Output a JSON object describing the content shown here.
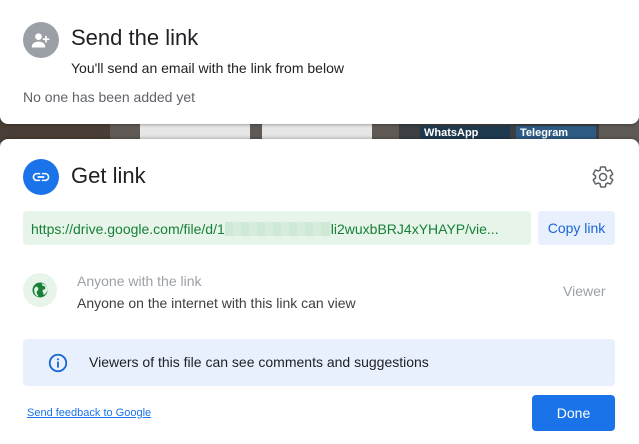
{
  "send_dialog": {
    "title": "Send the link",
    "subtitle": "You'll send an email with the link from below",
    "empty_state": "No one has been added yet"
  },
  "background": {
    "tags": [
      "WhatsApp",
      "Telegram"
    ]
  },
  "get_link_dialog": {
    "title": "Get link",
    "link_prefix": "https://drive.google.com/file/d/1",
    "link_suffix": "li2wuxbBRJ4xYHAYP/vie...",
    "copy_label": "Copy link",
    "access_label": "Anyone with the link",
    "access_description": "Anyone on the internet with this link can view",
    "role": "Viewer",
    "info_text": "Viewers of this file can see comments and suggestions",
    "feedback_link": "Send feedback to Google",
    "done_label": "Done"
  },
  "colors": {
    "primary_blue": "#1a73e8",
    "link_green": "#188038",
    "link_bg": "#e6f4ea",
    "info_bg": "#e8f0fe"
  },
  "icons": [
    "person-add-icon",
    "link-icon",
    "gear-icon",
    "globe-icon",
    "info-icon"
  ]
}
